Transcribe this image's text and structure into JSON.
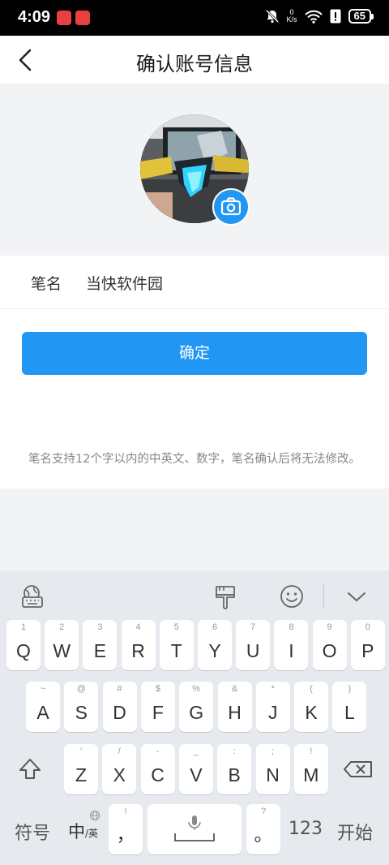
{
  "status_bar": {
    "time": "4:09",
    "net_speed_value": "0",
    "net_speed_unit": "K/s",
    "battery": "65"
  },
  "header": {
    "title": "确认账号信息"
  },
  "field": {
    "label": "笔名",
    "value": "当快软件园"
  },
  "confirm_button": "确定",
  "hint": "笔名支持12个字以内的中英文、数字，笔名确认后将无法修改。",
  "keyboard": {
    "row1": [
      {
        "k": "Q",
        "n": "1"
      },
      {
        "k": "W",
        "n": "2"
      },
      {
        "k": "E",
        "n": "3"
      },
      {
        "k": "R",
        "n": "4"
      },
      {
        "k": "T",
        "n": "5"
      },
      {
        "k": "Y",
        "n": "6"
      },
      {
        "k": "U",
        "n": "7"
      },
      {
        "k": "I",
        "n": "8"
      },
      {
        "k": "O",
        "n": "9"
      },
      {
        "k": "P",
        "n": "0"
      }
    ],
    "row2": [
      {
        "k": "A",
        "n": "~"
      },
      {
        "k": "S",
        "n": "@"
      },
      {
        "k": "D",
        "n": "#"
      },
      {
        "k": "F",
        "n": "$"
      },
      {
        "k": "G",
        "n": "%"
      },
      {
        "k": "H",
        "n": "&"
      },
      {
        "k": "J",
        "n": "*"
      },
      {
        "k": "K",
        "n": "("
      },
      {
        "k": "L",
        "n": ")"
      }
    ],
    "row3": [
      {
        "k": "Z",
        "n": "'"
      },
      {
        "k": "X",
        "n": "/"
      },
      {
        "k": "C",
        "n": "-"
      },
      {
        "k": "V",
        "n": "_"
      },
      {
        "k": "B",
        "n": ":"
      },
      {
        "k": "N",
        "n": ";"
      },
      {
        "k": "M",
        "n": "!"
      }
    ],
    "symbols": "符号",
    "zh": "中",
    "zh_sub": "/英",
    "comma": "，",
    "comma_sub": "!",
    "period": "。",
    "period_sub": "?",
    "numbers": "123",
    "start": "开始"
  },
  "colors": {
    "accent": "#2196f3",
    "page_bg": "#f2f3f5",
    "keyboard_bg": "#e6e9ee"
  }
}
